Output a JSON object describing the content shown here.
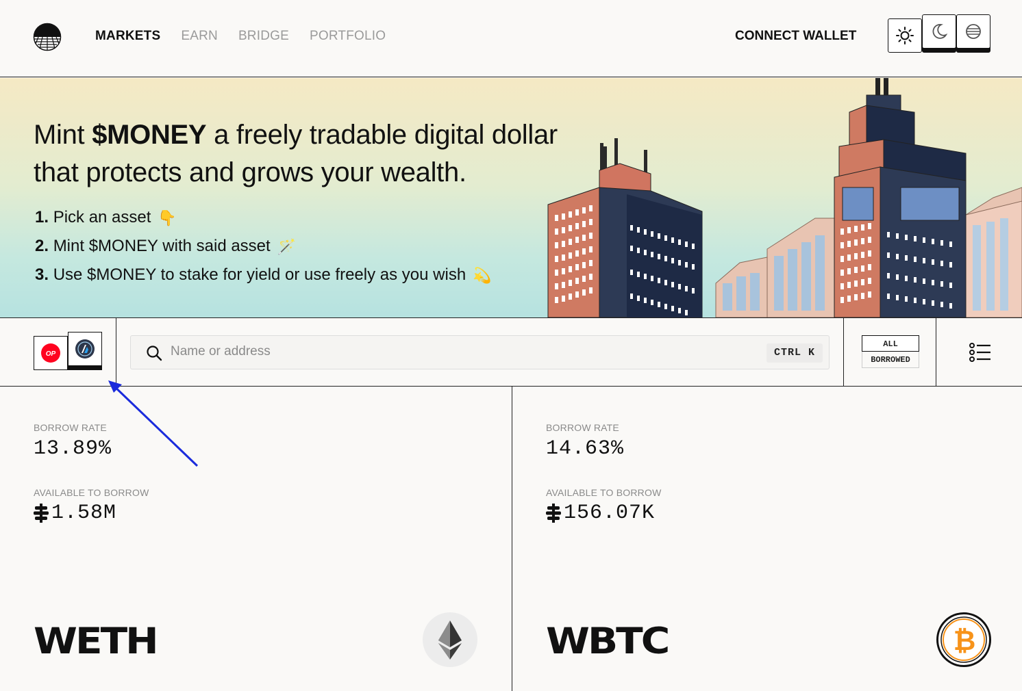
{
  "header": {
    "nav": [
      {
        "label": "MARKETS",
        "active": true
      },
      {
        "label": "EARN",
        "active": false
      },
      {
        "label": "BRIDGE",
        "active": false
      },
      {
        "label": "PORTFOLIO",
        "active": false
      }
    ],
    "connect_wallet": "CONNECT WALLET",
    "theme_options": [
      "sun-icon",
      "moon-icon",
      "globe-icon"
    ]
  },
  "hero": {
    "title_pre": "Mint ",
    "title_bold": "$MONEY",
    "title_post": " a freely tradable digital dollar that protects and grows your wealth.",
    "steps": [
      {
        "num": "1.",
        "text": "Pick an asset",
        "emoji": "👇"
      },
      {
        "num": "2.",
        "text": "Mint $MONEY with said asset",
        "emoji": "🪄"
      },
      {
        "num": "3.",
        "text": "Use $MONEY to stake for yield or use freely as you wish",
        "emoji": "💫"
      }
    ]
  },
  "filter": {
    "chains": [
      "OP",
      "arbitrum"
    ],
    "search_placeholder": "Name or address",
    "shortcut": "CTRL K",
    "toggle_all": "ALL",
    "toggle_borrowed": "BORROWED"
  },
  "markets": [
    {
      "borrow_rate_label": "BORROW RATE",
      "borrow_rate": "13.89%",
      "available_label": "AVAILABLE TO BORROW",
      "available": "1.58M",
      "token": "WETH",
      "icon": "ethereum-icon"
    },
    {
      "borrow_rate_label": "BORROW RATE",
      "borrow_rate": "14.63%",
      "available_label": "AVAILABLE TO BORROW",
      "available": "156.07K",
      "token": "WBTC",
      "icon": "bitcoin-icon"
    }
  ],
  "colors": {
    "accent": "#111111",
    "op_red": "#ff0420",
    "arbitrum_navy": "#2d374b",
    "bitcoin_orange": "#f7931a",
    "annotation_blue": "#1a2bdc"
  }
}
